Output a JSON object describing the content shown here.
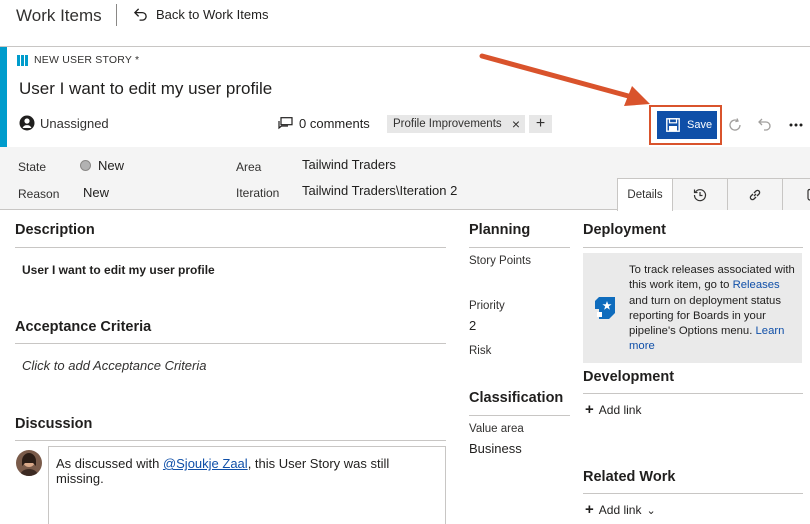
{
  "header": {
    "app_title": "Work Items",
    "back_label": "Back to Work Items"
  },
  "work_item": {
    "type_label": "NEW USER STORY *",
    "title": "User I want to edit my user profile",
    "assignee": "Unassigned",
    "comments_label": "0 comments",
    "tag": "Profile Improvements",
    "tag_remove": "×",
    "add_tag": "+",
    "save_label": "Save",
    "type_color": "#009ccc",
    "save_color": "#0f4fa8",
    "highlight_color": "#d9532c"
  },
  "fields": {
    "state_label": "State",
    "state_value": "New",
    "reason_label": "Reason",
    "reason_value": "New",
    "area_label": "Area",
    "area_value": "Tailwind Traders",
    "iteration_label": "Iteration",
    "iteration_value": "Tailwind Traders\\Iteration 2"
  },
  "tabs": [
    {
      "label": "Details",
      "icon": "details",
      "active": true
    },
    {
      "label": "",
      "icon": "history-icon"
    },
    {
      "label": "",
      "icon": "link-icon"
    },
    {
      "label": "",
      "icon": "attachment-icon"
    }
  ],
  "description": {
    "title": "Description",
    "text": "User I want to edit my user profile"
  },
  "acceptance": {
    "title": "Acceptance Criteria",
    "placeholder": "Click to add Acceptance Criteria"
  },
  "discussion": {
    "title": "Discussion",
    "text_before": "As discussed with ",
    "mention": "@Sjoukje Zaal",
    "text_after": ", this User Story was still missing."
  },
  "planning": {
    "title": "Planning",
    "story_points_label": "Story Points",
    "story_points_value": "",
    "priority_label": "Priority",
    "priority_value": "2",
    "risk_label": "Risk",
    "risk_value": ""
  },
  "classification": {
    "title": "Classification",
    "value_area_label": "Value area",
    "value_area_value": "Business"
  },
  "deployment": {
    "title": "Deployment",
    "text_1": "To track releases associated with this work item, go to ",
    "link_releases": "Releases",
    "text_2": " and turn on deployment status reporting for Boards in your pipeline's Options menu. ",
    "link_learn_more": "Learn more"
  },
  "development": {
    "title": "Development",
    "add_link": "Add link"
  },
  "related_work": {
    "title": "Related Work",
    "add_link": "Add link",
    "chevron": "⌄"
  }
}
